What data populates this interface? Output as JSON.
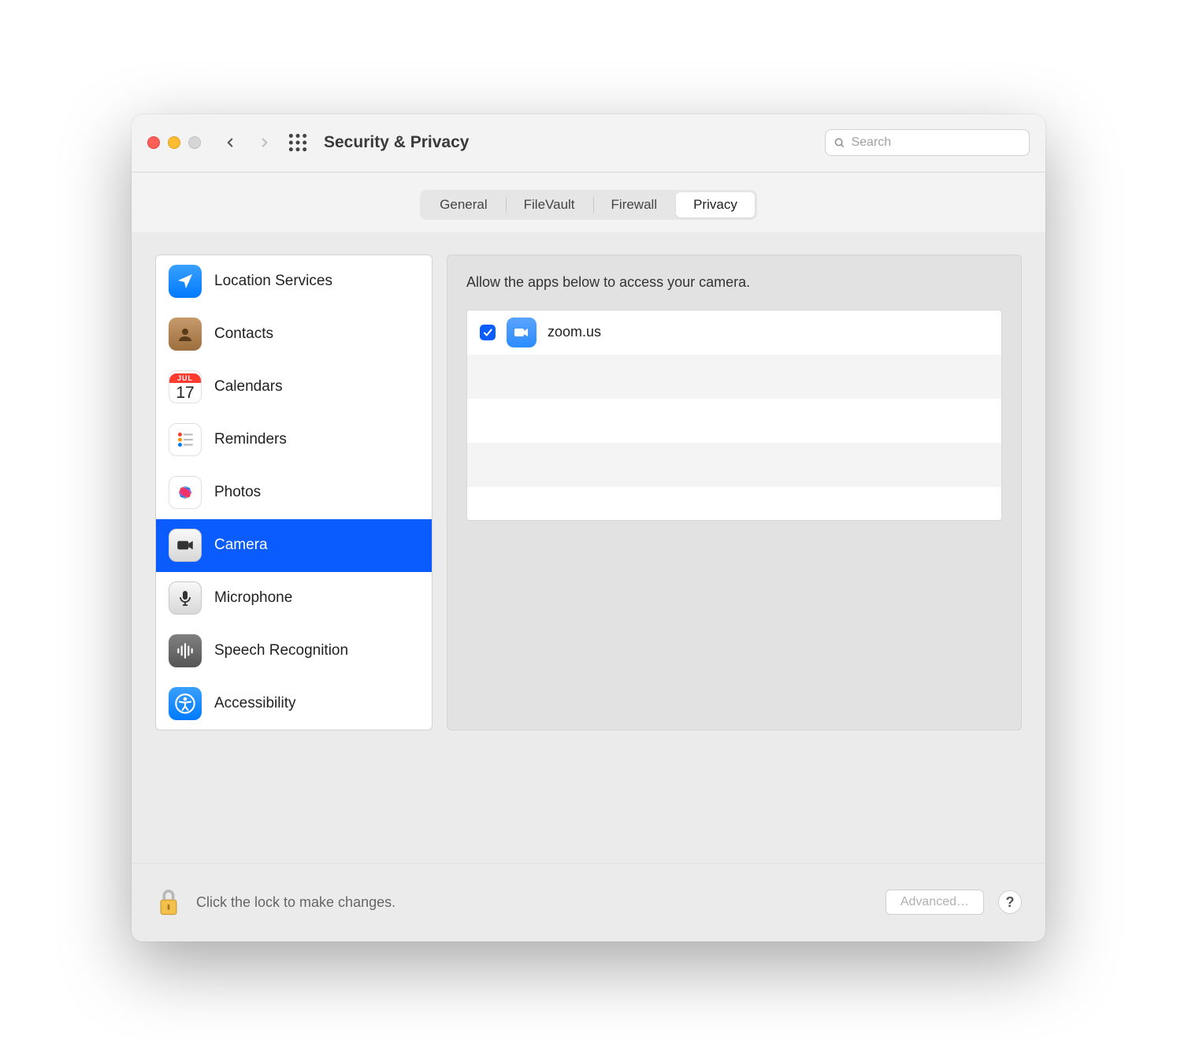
{
  "window": {
    "title": "Security & Privacy"
  },
  "search": {
    "placeholder": "Search"
  },
  "tabs": [
    {
      "label": "General",
      "active": false
    },
    {
      "label": "FileVault",
      "active": false
    },
    {
      "label": "Firewall",
      "active": false
    },
    {
      "label": "Privacy",
      "active": true
    }
  ],
  "sidebar": {
    "items": [
      {
        "label": "Location Services",
        "icon": "location"
      },
      {
        "label": "Contacts",
        "icon": "contacts"
      },
      {
        "label": "Calendars",
        "icon": "calendar",
        "cal_month": "JUL",
        "cal_day": "17"
      },
      {
        "label": "Reminders",
        "icon": "reminders"
      },
      {
        "label": "Photos",
        "icon": "photos"
      },
      {
        "label": "Camera",
        "icon": "camera",
        "selected": true
      },
      {
        "label": "Microphone",
        "icon": "microphone"
      },
      {
        "label": "Speech Recognition",
        "icon": "speech"
      },
      {
        "label": "Accessibility",
        "icon": "accessibility"
      }
    ]
  },
  "detail": {
    "prompt": "Allow the apps below to access your camera.",
    "apps": [
      {
        "name": "zoom.us",
        "checked": true
      }
    ]
  },
  "footer": {
    "lock_text": "Click the lock to make changes.",
    "advanced": "Advanced…",
    "help": "?"
  }
}
